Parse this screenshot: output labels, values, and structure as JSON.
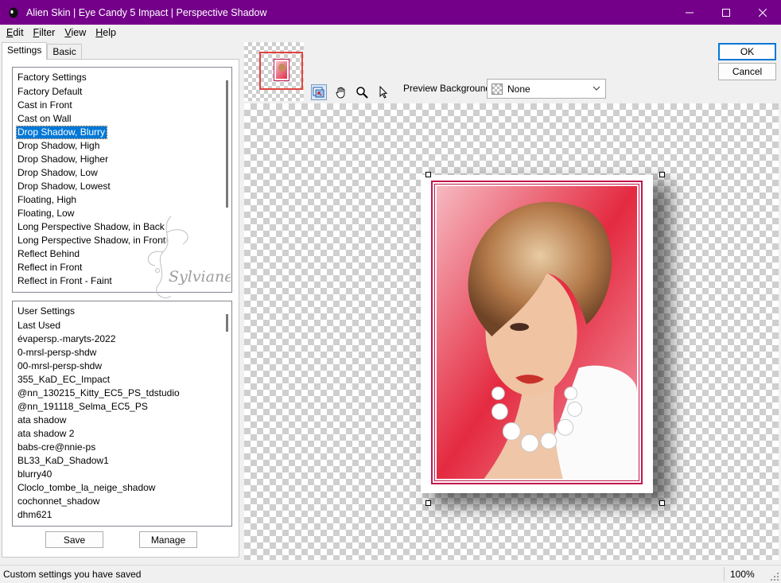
{
  "window": {
    "title": "Alien Skin | Eye Candy 5 Impact | Perspective Shadow",
    "minimize_icon": "minimize-icon",
    "maximize_icon": "maximize-icon",
    "close_icon": "close-icon",
    "titlebar_color": "#74008a"
  },
  "menu": {
    "items": [
      {
        "label": "Edit",
        "accel": "E",
        "rest": "dit"
      },
      {
        "label": "Filter",
        "accel": "F",
        "rest": "ilter"
      },
      {
        "label": "View",
        "accel": "V",
        "rest": "iew"
      },
      {
        "label": "Help",
        "accel": "H",
        "rest": "elp"
      }
    ]
  },
  "tabs": [
    {
      "label": "Settings",
      "active": true
    },
    {
      "label": "Basic",
      "active": false
    }
  ],
  "factory_settings": {
    "header": "Factory Settings",
    "items": [
      "Factory Default",
      "Cast in Front",
      "Cast on Wall",
      "Drop Shadow, Blurry",
      "Drop Shadow, High",
      "Drop Shadow, Higher",
      "Drop Shadow, Low",
      "Drop Shadow, Lowest",
      "Floating, High",
      "Floating, Low",
      "Long Perspective Shadow, in Back",
      "Long Perspective Shadow, in Front",
      "Reflect Behind",
      "Reflect in Front",
      "Reflect in Front - Faint"
    ],
    "selected": "Drop Shadow, Blurry"
  },
  "user_settings": {
    "header": "User Settings",
    "items": [
      "Last Used",
      "évapersp.-maryts-2022",
      "0-mrsl-persp-shdw",
      "00-mrsl-persp-shdw",
      "355_KaD_EC_Impact",
      "@nn_130215_Kitty_EC5_PS_tdstudio",
      "@nn_191118_Selma_EC5_PS",
      "ata shadow",
      "ata shadow 2",
      "babs-cre@nnie-ps",
      "BL33_KaD_Shadow1",
      "blurry40",
      "Cloclo_tombe_la_neige_shadow",
      "cochonnet_shadow",
      "dhm621"
    ]
  },
  "buttons": {
    "save": "Save",
    "manage": "Manage",
    "ok": "OK",
    "cancel": "Cancel"
  },
  "toolbar": {
    "tools": [
      "navigate-preview-icon",
      "hand-pan-icon",
      "zoom-magnifier-icon",
      "pointer-arrow-icon"
    ],
    "preview_background_label": "Preview Background:",
    "preview_background_value": "None"
  },
  "watermark": "Sylviane",
  "status": {
    "message": "Custom settings you have saved",
    "zoom": "100%"
  },
  "colors": {
    "selection": "#0078d7",
    "frame_border": "#c2164a"
  }
}
